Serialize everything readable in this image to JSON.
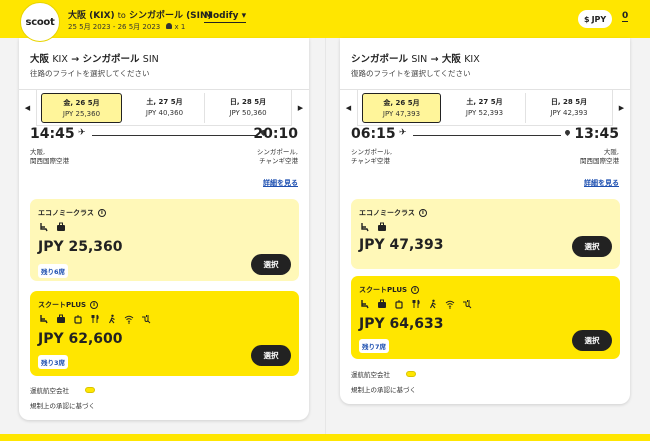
{
  "header": {
    "logo_text": "scoot",
    "route_from": "大阪 (KIX)",
    "route_to_word": "to",
    "route_to": "シンガポール (SIN)",
    "dates": "25 5月 2023 - 26 5月 2023",
    "pax": "x 1",
    "modify_label": "Modify",
    "currency": "JPY",
    "currency_symbol": "$",
    "cart_count": "0"
  },
  "outbound": {
    "title_from": "大阪",
    "title_from_code": "KIX",
    "title_to": "シンガポール",
    "title_to_code": "SIN",
    "subtitle": "往路のフライトを選択してください",
    "dates": [
      {
        "day": "金, 26 5月",
        "price": "JPY 25,360"
      },
      {
        "day": "土, 27 5月",
        "price": "JPY 40,360"
      },
      {
        "day": "日, 28 5月",
        "price": "JPY 50,360"
      }
    ],
    "dep_time": "14:45",
    "arr_time": "20:10",
    "dep_city_1": "大阪,",
    "dep_city_2": "関西国際空港",
    "arr_city_1": "シンガポール,",
    "arr_city_2": "チャンギ空港",
    "details_label": "詳細を見る",
    "economy": {
      "name": "エコノミークラス",
      "price": "JPY 25,360",
      "seats": "残り6席",
      "select": "選択"
    },
    "plus": {
      "name": "スクートPLUS",
      "price": "JPY 62,600",
      "seats": "残り3席",
      "select": "選択"
    },
    "operator": "運航航空会社",
    "approval": "規制上の承認に基づく"
  },
  "inbound": {
    "title_from": "シンガポール",
    "title_from_code": "SIN",
    "title_to": "大阪",
    "title_to_code": "KIX",
    "subtitle": "復路のフライトを選択してください",
    "dates": [
      {
        "day": "金, 26 5月",
        "price": "JPY 47,393"
      },
      {
        "day": "土, 27 5月",
        "price": "JPY 52,393"
      },
      {
        "day": "日, 28 5月",
        "price": "JPY 42,393"
      }
    ],
    "dep_time": "06:15",
    "arr_time": "13:45",
    "dep_city_1": "シンガポール,",
    "dep_city_2": "チャンギ空港",
    "arr_city_1": "大阪,",
    "arr_city_2": "関西国際空港",
    "details_label": "詳細を見る",
    "economy": {
      "name": "エコノミークラス",
      "price": "JPY 47,393",
      "select": "選択"
    },
    "plus": {
      "name": "スクートPLUS",
      "price": "JPY 64,633",
      "seats": "残り7席",
      "select": "選択"
    },
    "operator": "運航航空会社",
    "approval": "規制上の承認に基づく"
  },
  "colors": {
    "brand_yellow": "#ffe600",
    "economy_bg": "#fff8b8",
    "link_blue": "#1d4fb0",
    "button_dark": "#222222"
  },
  "icons": {
    "economy_amenities": [
      "seat-icon",
      "baggage-icon"
    ],
    "plus_amenities": [
      "seat-icon",
      "baggage-icon",
      "cabin-bag-icon",
      "meal-icon",
      "priority-boarding-icon",
      "wifi-icon",
      "power-icon"
    ]
  }
}
